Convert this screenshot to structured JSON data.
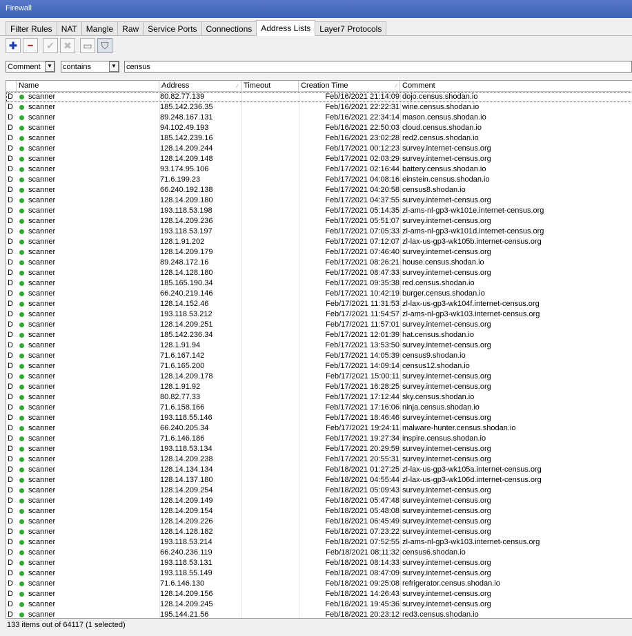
{
  "window": {
    "title": "Firewall"
  },
  "tabs": [
    {
      "label": "Filter Rules",
      "active": false
    },
    {
      "label": "NAT",
      "active": false
    },
    {
      "label": "Mangle",
      "active": false
    },
    {
      "label": "Raw",
      "active": false
    },
    {
      "label": "Service Ports",
      "active": false
    },
    {
      "label": "Connections",
      "active": false
    },
    {
      "label": "Address Lists",
      "active": true
    },
    {
      "label": "Layer7 Protocols",
      "active": false
    }
  ],
  "toolbar": {
    "add_icon": "plus-icon",
    "remove_icon": "minus-icon",
    "enable_icon": "check-icon",
    "disable_icon": "x-icon",
    "comment_icon": "note-icon",
    "filter_icon": "funnel-icon",
    "add_glyph": "✚",
    "remove_glyph": "━",
    "enable_glyph": "✔",
    "disable_glyph": "✖",
    "comment_glyph": "▭",
    "filter_glyph": "⛉"
  },
  "filter": {
    "field": "Comment",
    "operator": "contains",
    "value": "census",
    "dropdown_glyph": "▼"
  },
  "columns": {
    "name": "Name",
    "address": "Address",
    "timeout": "Timeout",
    "creation_time": "Creation Time",
    "comment": "Comment",
    "sort_glyph": "∕"
  },
  "colors": {
    "dynamic_dot": "#2ea82e",
    "titlebar": "#4a6ec0"
  },
  "rows": [
    [
      "D",
      "scanner",
      "80.82.77.139",
      "",
      "Feb/16/2021 21:14:09",
      "dojo.census.shodan.io"
    ],
    [
      "D",
      "scanner",
      "185.142.236.35",
      "",
      "Feb/16/2021 22:22:31",
      "wine.census.shodan.io"
    ],
    [
      "D",
      "scanner",
      "89.248.167.131",
      "",
      "Feb/16/2021 22:34:14",
      "mason.census.shodan.io"
    ],
    [
      "D",
      "scanner",
      "94.102.49.193",
      "",
      "Feb/16/2021 22:50:03",
      "cloud.census.shodan.io"
    ],
    [
      "D",
      "scanner",
      "185.142.239.16",
      "",
      "Feb/16/2021 23:02:28",
      "red2.census.shodan.io"
    ],
    [
      "D",
      "scanner",
      "128.14.209.244",
      "",
      "Feb/17/2021 00:12:23",
      "survey.internet-census.org"
    ],
    [
      "D",
      "scanner",
      "128.14.209.148",
      "",
      "Feb/17/2021 02:03:29",
      "survey.internet-census.org"
    ],
    [
      "D",
      "scanner",
      "93.174.95.106",
      "",
      "Feb/17/2021 02:16:44",
      "battery.census.shodan.io"
    ],
    [
      "D",
      "scanner",
      "71.6.199.23",
      "",
      "Feb/17/2021 04:08:16",
      "einstein.census.shodan.io"
    ],
    [
      "D",
      "scanner",
      "66.240.192.138",
      "",
      "Feb/17/2021 04:20:58",
      "census8.shodan.io"
    ],
    [
      "D",
      "scanner",
      "128.14.209.180",
      "",
      "Feb/17/2021 04:37:55",
      "survey.internet-census.org"
    ],
    [
      "D",
      "scanner",
      "193.118.53.198",
      "",
      "Feb/17/2021 05:14:35",
      "zl-ams-nl-gp3-wk101e.internet-census.org"
    ],
    [
      "D",
      "scanner",
      "128.14.209.236",
      "",
      "Feb/17/2021 05:51:07",
      "survey.internet-census.org"
    ],
    [
      "D",
      "scanner",
      "193.118.53.197",
      "",
      "Feb/17/2021 07:05:33",
      "zl-ams-nl-gp3-wk101d.internet-census.org"
    ],
    [
      "D",
      "scanner",
      "128.1.91.202",
      "",
      "Feb/17/2021 07:12:07",
      "zl-lax-us-gp3-wk105b.internet-census.org"
    ],
    [
      "D",
      "scanner",
      "128.14.209.179",
      "",
      "Feb/17/2021 07:46:40",
      "survey.internet-census.org"
    ],
    [
      "D",
      "scanner",
      "89.248.172.16",
      "",
      "Feb/17/2021 08:26:21",
      "house.census.shodan.io"
    ],
    [
      "D",
      "scanner",
      "128.14.128.180",
      "",
      "Feb/17/2021 08:47:33",
      "survey.internet-census.org"
    ],
    [
      "D",
      "scanner",
      "185.165.190.34",
      "",
      "Feb/17/2021 09:35:38",
      "red.census.shodan.io"
    ],
    [
      "D",
      "scanner",
      "66.240.219.146",
      "",
      "Feb/17/2021 10:42:19",
      "burger.census.shodan.io"
    ],
    [
      "D",
      "scanner",
      "128.14.152.46",
      "",
      "Feb/17/2021 11:31:53",
      "zl-lax-us-gp3-wk104f.internet-census.org"
    ],
    [
      "D",
      "scanner",
      "193.118.53.212",
      "",
      "Feb/17/2021 11:54:57",
      "zl-ams-nl-gp3-wk103.internet-census.org"
    ],
    [
      "D",
      "scanner",
      "128.14.209.251",
      "",
      "Feb/17/2021 11:57:01",
      "survey.internet-census.org"
    ],
    [
      "D",
      "scanner",
      "185.142.236.34",
      "",
      "Feb/17/2021 12:01:39",
      "hat.census.shodan.io"
    ],
    [
      "D",
      "scanner",
      "128.1.91.94",
      "",
      "Feb/17/2021 13:53:50",
      "survey.internet-census.org"
    ],
    [
      "D",
      "scanner",
      "71.6.167.142",
      "",
      "Feb/17/2021 14:05:39",
      "census9.shodan.io"
    ],
    [
      "D",
      "scanner",
      "71.6.165.200",
      "",
      "Feb/17/2021 14:09:14",
      "census12.shodan.io"
    ],
    [
      "D",
      "scanner",
      "128.14.209.178",
      "",
      "Feb/17/2021 15:00:11",
      "survey.internet-census.org"
    ],
    [
      "D",
      "scanner",
      "128.1.91.92",
      "",
      "Feb/17/2021 16:28:25",
      "survey.internet-census.org"
    ],
    [
      "D",
      "scanner",
      "80.82.77.33",
      "",
      "Feb/17/2021 17:12:44",
      "sky.census.shodan.io"
    ],
    [
      "D",
      "scanner",
      "71.6.158.166",
      "",
      "Feb/17/2021 17:16:06",
      "ninja.census.shodan.io"
    ],
    [
      "D",
      "scanner",
      "193.118.55.146",
      "",
      "Feb/17/2021 18:46:46",
      "survey.internet-census.org"
    ],
    [
      "D",
      "scanner",
      "66.240.205.34",
      "",
      "Feb/17/2021 19:24:11",
      "malware-hunter.census.shodan.io"
    ],
    [
      "D",
      "scanner",
      "71.6.146.186",
      "",
      "Feb/17/2021 19:27:34",
      "inspire.census.shodan.io"
    ],
    [
      "D",
      "scanner",
      "193.118.53.134",
      "",
      "Feb/17/2021 20:29:59",
      "survey.internet-census.org"
    ],
    [
      "D",
      "scanner",
      "128.14.209.238",
      "",
      "Feb/17/2021 20:55:31",
      "survey.internet-census.org"
    ],
    [
      "D",
      "scanner",
      "128.14.134.134",
      "",
      "Feb/18/2021 01:27:25",
      "zl-lax-us-gp3-wk105a.internet-census.org"
    ],
    [
      "D",
      "scanner",
      "128.14.137.180",
      "",
      "Feb/18/2021 04:55:44",
      "zl-lax-us-gp3-wk106d.internet-census.org"
    ],
    [
      "D",
      "scanner",
      "128.14.209.254",
      "",
      "Feb/18/2021 05:09:43",
      "survey.internet-census.org"
    ],
    [
      "D",
      "scanner",
      "128.14.209.149",
      "",
      "Feb/18/2021 05:47:48",
      "survey.internet-census.org"
    ],
    [
      "D",
      "scanner",
      "128.14.209.154",
      "",
      "Feb/18/2021 05:48:08",
      "survey.internet-census.org"
    ],
    [
      "D",
      "scanner",
      "128.14.209.226",
      "",
      "Feb/18/2021 06:45:49",
      "survey.internet-census.org"
    ],
    [
      "D",
      "scanner",
      "128.14.128.182",
      "",
      "Feb/18/2021 07:23:22",
      "survey.internet-census.org"
    ],
    [
      "D",
      "scanner",
      "193.118.53.214",
      "",
      "Feb/18/2021 07:52:55",
      "zl-ams-nl-gp3-wk103.internet-census.org"
    ],
    [
      "D",
      "scanner",
      "66.240.236.119",
      "",
      "Feb/18/2021 08:11:32",
      "census6.shodan.io"
    ],
    [
      "D",
      "scanner",
      "193.118.53.131",
      "",
      "Feb/18/2021 08:14:33",
      "survey.internet-census.org"
    ],
    [
      "D",
      "scanner",
      "193.118.55.149",
      "",
      "Feb/18/2021 08:47:09",
      "survey.internet-census.org"
    ],
    [
      "D",
      "scanner",
      "71.6.146.130",
      "",
      "Feb/18/2021 09:25:08",
      "refrigerator.census.shodan.io"
    ],
    [
      "D",
      "scanner",
      "128.14.209.156",
      "",
      "Feb/18/2021 14:26:43",
      "survey.internet-census.org"
    ],
    [
      "D",
      "scanner",
      "128.14.209.245",
      "",
      "Feb/18/2021 19:45:36",
      "survey.internet-census.org"
    ],
    [
      "D",
      "scanner",
      "195.144.21.56",
      "",
      "Feb/18/2021 20:23:12",
      "red3.census.shodan.io"
    ]
  ],
  "status": {
    "text": "133 items out of 64117 (1 selected)"
  }
}
